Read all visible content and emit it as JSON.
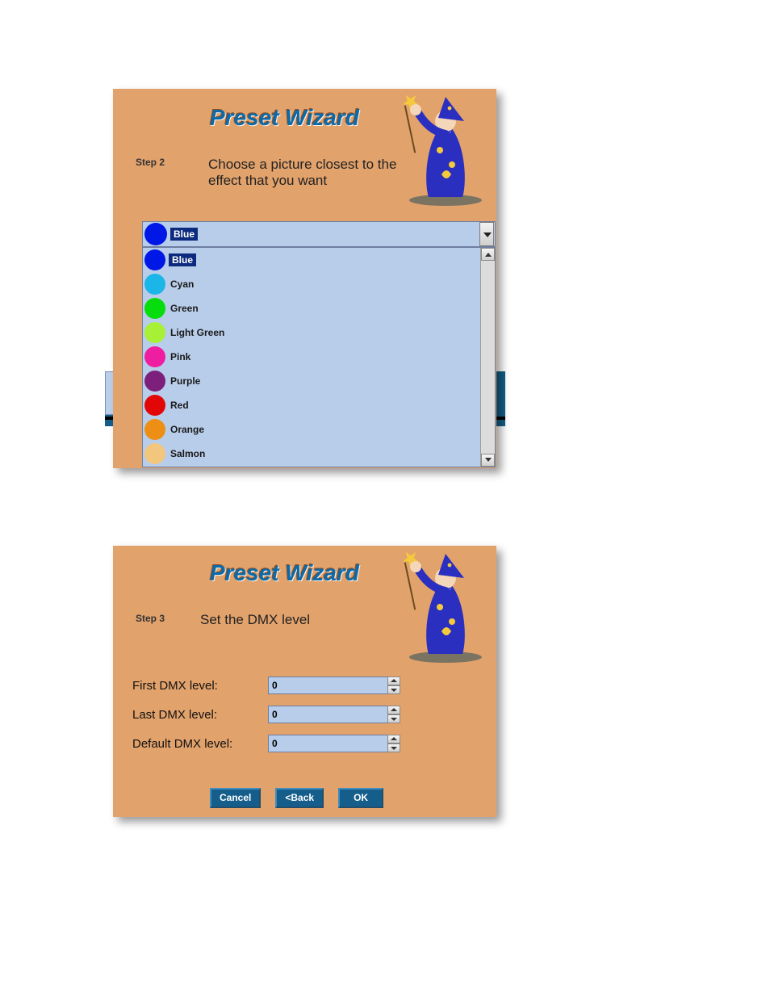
{
  "step2": {
    "title": "Preset Wizard",
    "step_label": "Step 2",
    "instruction": "Choose a picture closest to the effect that you want",
    "selected": {
      "label": "Blue",
      "color": "#0018e6"
    },
    "options": [
      {
        "label": "Blue",
        "color": "#0018e6",
        "selected": true
      },
      {
        "label": "Cyan",
        "color": "#1bb6e8"
      },
      {
        "label": "Green",
        "color": "#07dc0c"
      },
      {
        "label": "Light Green",
        "color": "#a8f035"
      },
      {
        "label": "Pink",
        "color": "#ef1da0"
      },
      {
        "label": "Purple",
        "color": "#7c207c"
      },
      {
        "label": "Red",
        "color": "#e30606"
      },
      {
        "label": "Orange",
        "color": "#ec8f14"
      },
      {
        "label": "Salmon",
        "color": "#f3c67e"
      }
    ]
  },
  "step3": {
    "title": "Preset Wizard",
    "step_label": "Step 3",
    "instruction": "Set the DMX level",
    "fields": {
      "first": {
        "label": "First DMX level:",
        "value": "0"
      },
      "last": {
        "label": "Last DMX level:",
        "value": "0"
      },
      "default": {
        "label": "Default DMX level:",
        "value": "0"
      }
    },
    "buttons": {
      "cancel": "Cancel",
      "back": "<Back",
      "ok": "OK"
    }
  }
}
